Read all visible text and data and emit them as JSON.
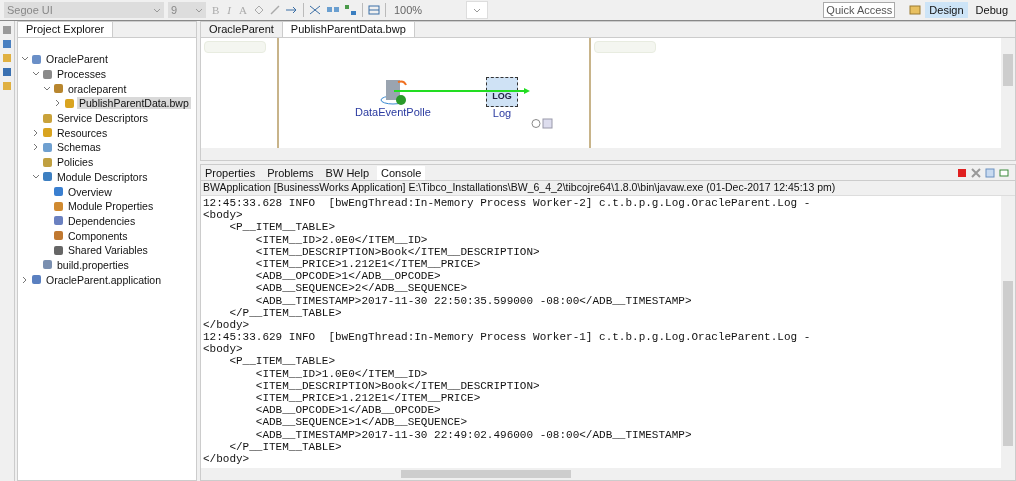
{
  "toolbar": {
    "font": "Segoe UI",
    "size": "9",
    "text_buttons": [
      "B",
      "I",
      "A"
    ],
    "zoom": "100%",
    "quick_access": {
      "placeholder": "Quick Access"
    },
    "perspectives": [
      {
        "label": "Design",
        "selected": true
      },
      {
        "label": "Debug",
        "selected": false
      }
    ]
  },
  "project_explorer": {
    "title": "Project Explorer",
    "tree": [
      {
        "label": "OracleParent",
        "expanded": true,
        "selected": false,
        "children": [
          {
            "label": "Processes",
            "expanded": true,
            "selected": false,
            "children": [
              {
                "label": "oracleparent",
                "expanded": true,
                "selected": false,
                "children": [
                  {
                    "label": "PublishParentData.bwp",
                    "expanded": false,
                    "selected": true
                  }
                ]
              }
            ]
          },
          {
            "label": "Service Descriptors",
            "selected": false
          },
          {
            "label": "Resources",
            "expanded": false,
            "selected": false
          },
          {
            "label": "Schemas",
            "expanded": false,
            "selected": false
          },
          {
            "label": "Policies",
            "selected": false
          },
          {
            "label": "Module Descriptors",
            "expanded": true,
            "selected": false,
            "children": [
              {
                "label": "Overview",
                "selected": false
              },
              {
                "label": "Module Properties",
                "selected": false
              },
              {
                "label": "Dependencies",
                "selected": false
              },
              {
                "label": "Components",
                "selected": false
              },
              {
                "label": "Shared Variables",
                "selected": false
              }
            ]
          },
          {
            "label": "build.properties",
            "selected": false
          }
        ]
      },
      {
        "label": "OracleParent.application",
        "expanded": false,
        "selected": false
      }
    ]
  },
  "editor": {
    "tabs": [
      {
        "label": "OracleParent",
        "selected": false
      },
      {
        "label": "PublishParentData.bwp",
        "selected": true
      }
    ],
    "nodes": [
      {
        "label": "DataEventPolle",
        "kind": "poller"
      },
      {
        "label": "Log",
        "kind": "log",
        "selected": true,
        "icon_text": "LOG"
      }
    ]
  },
  "console": {
    "tabs": [
      {
        "label": "Properties",
        "selected": false
      },
      {
        "label": "Problems",
        "selected": false
      },
      {
        "label": "BW Help",
        "selected": false
      },
      {
        "label": "Console",
        "selected": true
      }
    ],
    "header": "BWApplication [BusinessWorks Application] E:\\Tibco_Installations\\BW_6_4_2\\tibcojre64\\1.8.0\\bin\\javaw.exe (01-Dec-2017 12:45:13 pm)",
    "lines": [
      "12:45:33.628 INFO  [bwEngThread:In-Memory Process Worker-2] c.t.b.p.g.Log.OracleParent.Log -",
      "<body>",
      "    <P__ITEM__TABLE>",
      "        <ITEM__ID>2.0E0</ITEM__ID>",
      "        <ITEM__DESCRIPTION>Book</ITEM__DESCRIPTION>",
      "        <ITEM__PRICE>1.212E1</ITEM__PRICE>",
      "        <ADB__OPCODE>1</ADB__OPCODE>",
      "        <ADB__SEQUENCE>2</ADB__SEQUENCE>",
      "        <ADB__TIMESTAMP>2017-11-30 22:50:35.599000 -08:00</ADB__TIMESTAMP>",
      "    </P__ITEM__TABLE>",
      "</body>",
      "12:45:33.629 INFO  [bwEngThread:In-Memory Process Worker-1] c.t.b.p.g.Log.OracleParent.Log -",
      "<body>",
      "    <P__ITEM__TABLE>",
      "        <ITEM__ID>1.0E0</ITEM__ID>",
      "        <ITEM__DESCRIPTION>Book</ITEM__DESCRIPTION>",
      "        <ITEM__PRICE>1.212E1</ITEM__PRICE>",
      "        <ADB__OPCODE>1</ADB__OPCODE>",
      "        <ADB__SEQUENCE>1</ADB__SEQUENCE>",
      "        <ADB__TIMESTAMP>2017-11-30 22:49:02.496000 -08:00</ADB__TIMESTAMP>",
      "    </P__ITEM__TABLE>",
      "</body>"
    ]
  }
}
